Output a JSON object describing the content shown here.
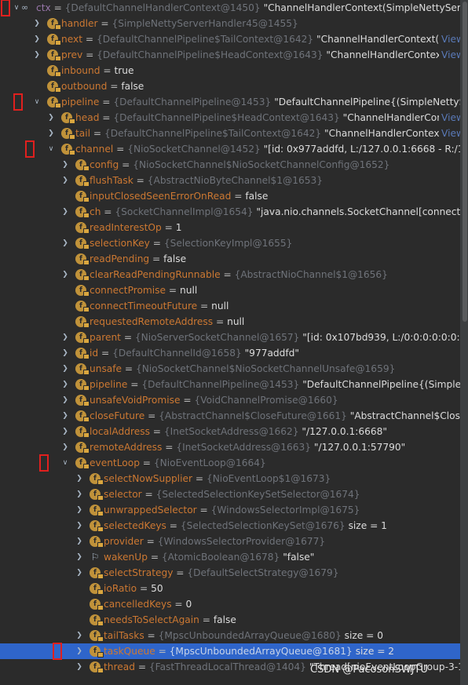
{
  "colors": {
    "background": "#2b2b2b",
    "selection": "#2f65ca",
    "field_name": "#cc7832",
    "type_text": "#6f737a",
    "annotation_box": "#e0201e",
    "field_icon": "#c0923a"
  },
  "rows": [
    {
      "name": "ctx",
      "type": "{DefaultChannelHandlerContext@1450}",
      "value": "\"ChannelHandlerContext(SimpleNettyServerHandl",
      "level": 0,
      "arrow": "down",
      "icon": "watch-glasses-icon",
      "view": ""
    },
    {
      "name": "handler",
      "type": "{SimpleNettyServerHandler45@1455}",
      "value": "",
      "level": 1,
      "arrow": "right",
      "icon": "field-icon",
      "view": ""
    },
    {
      "name": "next",
      "type": "{DefaultChannelPipeline$TailContext@1642}",
      "value": "\"ChannelHandlerContext(Default",
      "level": 1,
      "arrow": "right",
      "icon": "field-icon",
      "view": "View"
    },
    {
      "name": "prev",
      "type": "{DefaultChannelPipeline$HeadContext@1643}",
      "value": "\"ChannelHandlerContext(Defa",
      "level": 1,
      "arrow": "right",
      "icon": "field-icon",
      "view": "View"
    },
    {
      "name": "inbound",
      "type": "",
      "value": "true",
      "level": 1,
      "arrow": "",
      "icon": "field-icon",
      "view": ""
    },
    {
      "name": "outbound",
      "type": "",
      "value": "false",
      "level": 1,
      "arrow": "",
      "icon": "field-icon",
      "view": ""
    },
    {
      "name": "pipeline",
      "type": "{DefaultChannelPipeline@1453}",
      "value": "\"DefaultChannelPipeline{(SimpleNettyServerHan",
      "level": 1,
      "arrow": "down",
      "icon": "field-icon",
      "view": ""
    },
    {
      "name": "head",
      "type": "{DefaultChannelPipeline$HeadContext@1643}",
      "value": "\"ChannelHandlerContext(D",
      "level": 2,
      "arrow": "right",
      "icon": "field-icon",
      "view": "View"
    },
    {
      "name": "tail",
      "type": "{DefaultChannelPipeline$TailContext@1642}",
      "value": "\"ChannelHandlerContext(Defau",
      "level": 2,
      "arrow": "right",
      "icon": "field-icon",
      "view": "View"
    },
    {
      "name": "channel",
      "type": "{NioSocketChannel@1452}",
      "value": "\"[id: 0x977addfd, L:/127.0.0.1:6668 - R:/127.0.0.1:5",
      "level": 2,
      "arrow": "down",
      "icon": "field-icon",
      "view": ""
    },
    {
      "name": "config",
      "type": "{NioSocketChannel$NioSocketChannelConfig@1652}",
      "value": "",
      "level": 3,
      "arrow": "right",
      "icon": "field-icon",
      "view": ""
    },
    {
      "name": "flushTask",
      "type": "{AbstractNioByteChannel$1@1653}",
      "value": "",
      "level": 3,
      "arrow": "right",
      "icon": "field-icon",
      "view": ""
    },
    {
      "name": "inputClosedSeenErrorOnRead",
      "type": "",
      "value": "false",
      "level": 3,
      "arrow": "",
      "icon": "field-icon",
      "view": ""
    },
    {
      "name": "ch",
      "type": "{SocketChannelImpl@1654}",
      "value": "\"java.nio.channels.SocketChannel[connected local=",
      "level": 3,
      "arrow": "right",
      "icon": "field-icon",
      "view": ""
    },
    {
      "name": "readInterestOp",
      "type": "",
      "value": "1",
      "level": 3,
      "arrow": "",
      "icon": "field-icon",
      "view": ""
    },
    {
      "name": "selectionKey",
      "type": "{SelectionKeyImpl@1655}",
      "value": "",
      "level": 3,
      "arrow": "right",
      "icon": "field-icon",
      "view": ""
    },
    {
      "name": "readPending",
      "type": "",
      "value": "false",
      "level": 3,
      "arrow": "",
      "icon": "field-icon",
      "view": ""
    },
    {
      "name": "clearReadPendingRunnable",
      "type": "{AbstractNioChannel$1@1656}",
      "value": "",
      "level": 3,
      "arrow": "right",
      "icon": "field-icon",
      "view": ""
    },
    {
      "name": "connectPromise",
      "type": "",
      "value": "null",
      "level": 3,
      "arrow": "",
      "icon": "field-icon",
      "view": ""
    },
    {
      "name": "connectTimeoutFuture",
      "type": "",
      "value": "null",
      "level": 3,
      "arrow": "",
      "icon": "field-icon",
      "view": ""
    },
    {
      "name": "requestedRemoteAddress",
      "type": "",
      "value": "null",
      "level": 3,
      "arrow": "",
      "icon": "field-icon",
      "view": ""
    },
    {
      "name": "parent",
      "type": "{NioServerSocketChannel@1657}",
      "value": "\"[id: 0x107bd939, L:/0:0:0:0:0:0:0:0:6668]\"",
      "level": 3,
      "arrow": "right",
      "icon": "field-icon",
      "view": ""
    },
    {
      "name": "id",
      "type": "{DefaultChannelId@1658}",
      "value": "\"977addfd\"",
      "level": 3,
      "arrow": "right",
      "icon": "field-icon",
      "view": ""
    },
    {
      "name": "unsafe",
      "type": "{NioSocketChannel$NioSocketChannelUnsafe@1659}",
      "value": "",
      "level": 3,
      "arrow": "right",
      "icon": "field-icon",
      "view": ""
    },
    {
      "name": "pipeline",
      "type": "{DefaultChannelPipeline@1453}",
      "value": "\"DefaultChannelPipeline{(SimpleNettyServ",
      "level": 3,
      "arrow": "right",
      "icon": "field-icon",
      "view": ""
    },
    {
      "name": "unsafeVoidPromise",
      "type": "{VoidChannelPromise@1660}",
      "value": "",
      "level": 3,
      "arrow": "right",
      "icon": "field-icon",
      "view": ""
    },
    {
      "name": "closeFuture",
      "type": "{AbstractChannel$CloseFuture@1661}",
      "value": "\"AbstractChannel$CloseFuture@",
      "level": 3,
      "arrow": "right",
      "icon": "field-icon",
      "view": ""
    },
    {
      "name": "localAddress",
      "type": "{InetSocketAddress@1662}",
      "value": "\"/127.0.0.1:6668\"",
      "level": 3,
      "arrow": "right",
      "icon": "field-icon",
      "view": ""
    },
    {
      "name": "remoteAddress",
      "type": "{InetSocketAddress@1663}",
      "value": "\"/127.0.0.1:57790\"",
      "level": 3,
      "arrow": "right",
      "icon": "field-icon",
      "view": ""
    },
    {
      "name": "eventLoop",
      "type": "{NioEventLoop@1664}",
      "value": "",
      "level": 3,
      "arrow": "down",
      "icon": "field-icon",
      "view": ""
    },
    {
      "name": "selectNowSupplier",
      "type": "{NioEventLoop$1@1673}",
      "value": "",
      "level": 4,
      "arrow": "right",
      "icon": "field-icon",
      "view": ""
    },
    {
      "name": "selector",
      "type": "{SelectedSelectionKeySetSelector@1674}",
      "value": "",
      "level": 4,
      "arrow": "right",
      "icon": "field-icon",
      "view": ""
    },
    {
      "name": "unwrappedSelector",
      "type": "{WindowsSelectorImpl@1675}",
      "value": "",
      "level": 4,
      "arrow": "right",
      "icon": "field-icon",
      "view": ""
    },
    {
      "name": "selectedKeys",
      "type": "{SelectedSelectionKeySet@1676}",
      "value": "size = 1",
      "level": 4,
      "arrow": "right",
      "icon": "field-icon",
      "view": ""
    },
    {
      "name": "provider",
      "type": "{WindowsSelectorProvider@1677}",
      "value": "",
      "level": 4,
      "arrow": "right",
      "icon": "field-icon",
      "view": ""
    },
    {
      "name": "wakenUp",
      "type": "{AtomicBoolean@1678}",
      "value": "\"false\"",
      "level": 4,
      "arrow": "right",
      "icon": "flag-icon",
      "view": ""
    },
    {
      "name": "selectStrategy",
      "type": "{DefaultSelectStrategy@1679}",
      "value": "",
      "level": 4,
      "arrow": "right",
      "icon": "field-icon",
      "view": ""
    },
    {
      "name": "ioRatio",
      "type": "",
      "value": "50",
      "level": 4,
      "arrow": "",
      "icon": "field-icon",
      "view": ""
    },
    {
      "name": "cancelledKeys",
      "type": "",
      "value": "0",
      "level": 4,
      "arrow": "",
      "icon": "field-icon",
      "view": ""
    },
    {
      "name": "needsToSelectAgain",
      "type": "",
      "value": "false",
      "level": 4,
      "arrow": "",
      "icon": "field-icon",
      "view": ""
    },
    {
      "name": "tailTasks",
      "type": "{MpscUnboundedArrayQueue@1680}",
      "value": "size = 0",
      "level": 4,
      "arrow": "right",
      "icon": "field-icon",
      "view": ""
    },
    {
      "name": "taskQueue",
      "type": "{MpscUnboundedArrayQueue@1681}",
      "value": "size = 2",
      "level": 4,
      "arrow": "right",
      "icon": "field-icon",
      "view": "",
      "selected": true
    },
    {
      "name": "thread",
      "type": "{FastThreadLocalThread@1404}",
      "value": "\"Thread[nioEventLoopGroup-3-1,10,ma",
      "level": 4,
      "arrow": "right",
      "icon": "field-icon",
      "view": ""
    }
  ],
  "annotated_rows": [
    0,
    6,
    9,
    29,
    41
  ],
  "watermark": "CSDN @PacosonSWJTU"
}
